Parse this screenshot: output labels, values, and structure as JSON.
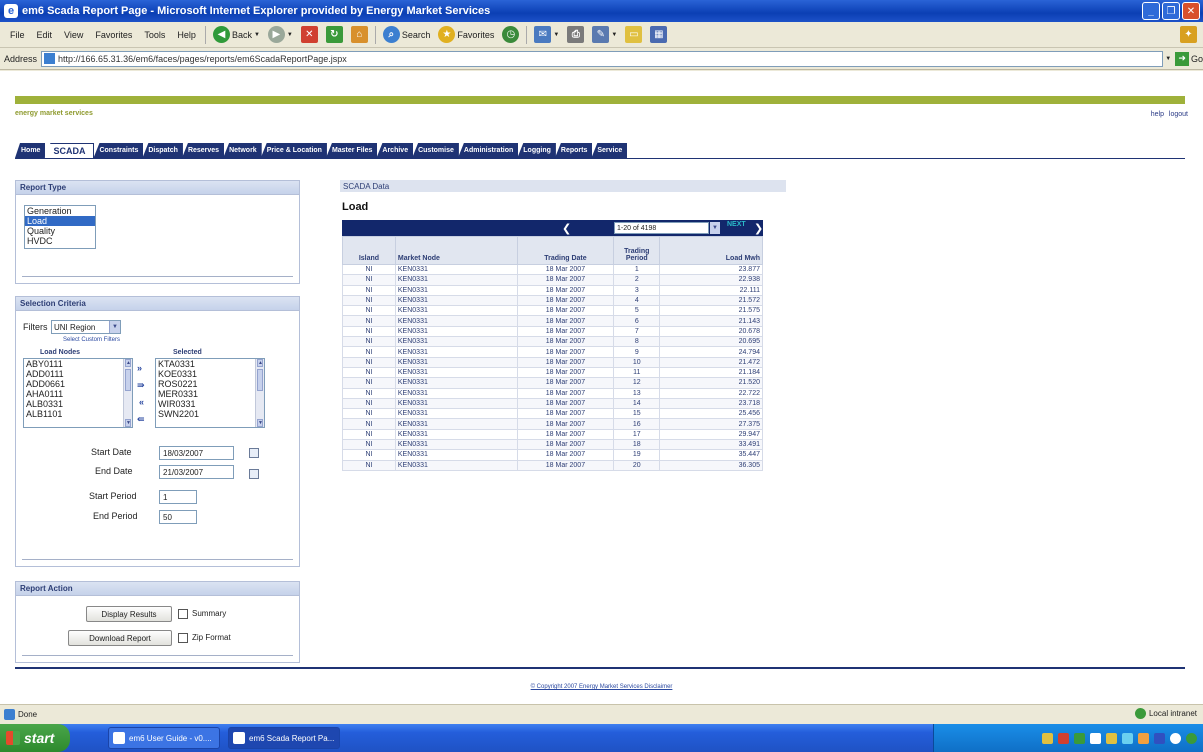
{
  "window": {
    "title": "em6 Scada Report Page - Microsoft Internet Explorer provided by Energy Market Services"
  },
  "menu": [
    "File",
    "Edit",
    "View",
    "Favorites",
    "Tools",
    "Help"
  ],
  "toolbar": {
    "back": "Back",
    "search": "Search",
    "favorites": "Favorites"
  },
  "address": {
    "label": "Address",
    "url": "http://166.65.31.36/em6/faces/pages/reports/em6ScadaReportPage.jspx",
    "go": "Go"
  },
  "header": {
    "brand": "energy market services",
    "help": "help",
    "logout": "logout"
  },
  "tabs": [
    "Home",
    "SCADA",
    "Constraints",
    "Dispatch",
    "Reserves",
    "Network",
    "Price & Location",
    "Master Files",
    "Archive",
    "Customise",
    "Administration",
    "Logging",
    "Reports",
    "Service"
  ],
  "active_tab": "SCADA",
  "report_type": {
    "title": "Report Type",
    "options": [
      "Generation",
      "Load",
      "Quality",
      "HVDC"
    ],
    "selected": "Load"
  },
  "selection": {
    "title": "Selection Criteria",
    "filters_label": "Filters",
    "filter_value": "UNI Region",
    "custom_filters": "Select Custom Filters",
    "load_nodes_label": "Load Nodes",
    "selected_label": "Selected",
    "load_nodes": [
      "ABY0111",
      "ADD0111",
      "ADD0661",
      "AHA0111",
      "ALB0331",
      "ALB1101"
    ],
    "selected_nodes": [
      "KTA0331",
      "KOE0331",
      "ROS0221",
      "MER0331",
      "WIR0331",
      "SWN2201"
    ],
    "start_date_label": "Start Date",
    "start_date": "18/03/2007",
    "end_date_label": "End Date",
    "end_date": "21/03/2007",
    "start_period_label": "Start Period",
    "start_period": "1",
    "end_period_label": "End Period",
    "end_period": "50"
  },
  "actions": {
    "title": "Report Action",
    "display": "Display Results",
    "summary": "Summary",
    "download": "Download Report",
    "zip": "Zip Format"
  },
  "data": {
    "section_title": "SCADA Data",
    "title": "Load",
    "range": "1-20 of 4198",
    "next": "NEXT",
    "columns": [
      "Island",
      "Market Node",
      "Trading Date",
      "Trading Period",
      "Load Mwh"
    ],
    "rows": [
      [
        "NI",
        "KEN0331",
        "18 Mar 2007",
        "1",
        "23.877"
      ],
      [
        "NI",
        "KEN0331",
        "18 Mar 2007",
        "2",
        "22.938"
      ],
      [
        "NI",
        "KEN0331",
        "18 Mar 2007",
        "3",
        "22.111"
      ],
      [
        "NI",
        "KEN0331",
        "18 Mar 2007",
        "4",
        "21.572"
      ],
      [
        "NI",
        "KEN0331",
        "18 Mar 2007",
        "5",
        "21.575"
      ],
      [
        "NI",
        "KEN0331",
        "18 Mar 2007",
        "6",
        "21.143"
      ],
      [
        "NI",
        "KEN0331",
        "18 Mar 2007",
        "7",
        "20.678"
      ],
      [
        "NI",
        "KEN0331",
        "18 Mar 2007",
        "8",
        "20.695"
      ],
      [
        "NI",
        "KEN0331",
        "18 Mar 2007",
        "9",
        "24.794"
      ],
      [
        "NI",
        "KEN0331",
        "18 Mar 2007",
        "10",
        "21.472"
      ],
      [
        "NI",
        "KEN0331",
        "18 Mar 2007",
        "11",
        "21.184"
      ],
      [
        "NI",
        "KEN0331",
        "18 Mar 2007",
        "12",
        "21.520"
      ],
      [
        "NI",
        "KEN0331",
        "18 Mar 2007",
        "13",
        "22.722"
      ],
      [
        "NI",
        "KEN0331",
        "18 Mar 2007",
        "14",
        "23.718"
      ],
      [
        "NI",
        "KEN0331",
        "18 Mar 2007",
        "15",
        "25.456"
      ],
      [
        "NI",
        "KEN0331",
        "18 Mar 2007",
        "16",
        "27.375"
      ],
      [
        "NI",
        "KEN0331",
        "18 Mar 2007",
        "17",
        "29.947"
      ],
      [
        "NI",
        "KEN0331",
        "18 Mar 2007",
        "18",
        "33.491"
      ],
      [
        "NI",
        "KEN0331",
        "18 Mar 2007",
        "19",
        "35.447"
      ],
      [
        "NI",
        "KEN0331",
        "18 Mar 2007",
        "20",
        "36.305"
      ]
    ]
  },
  "footer": {
    "copyright": "© Copyright 2007 Energy Market Services Disclaimer"
  },
  "status": {
    "left": "Done",
    "zone": "Local intranet"
  },
  "taskbar": {
    "start": "start",
    "tasks": [
      "em6 User Guide - v0....",
      "em6 Scada Report Pa..."
    ]
  },
  "colors": {
    "accent_green": "#9fb13a",
    "nav_blue": "#1f3374",
    "select_blue": "#316ac5"
  }
}
